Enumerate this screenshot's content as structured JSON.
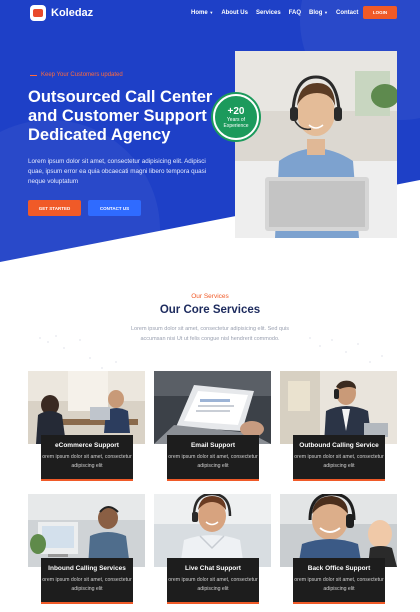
{
  "brand": {
    "name": "Koledaz"
  },
  "nav": {
    "items": [
      {
        "label": "Home",
        "dropdown": true
      },
      {
        "label": "About Us",
        "dropdown": false
      },
      {
        "label": "Services",
        "dropdown": false
      },
      {
        "label": "FAQ",
        "dropdown": false
      },
      {
        "label": "Blog",
        "dropdown": true
      },
      {
        "label": "Contact",
        "dropdown": false
      }
    ],
    "login_label": "LOGIN"
  },
  "hero": {
    "kicker": "Keep Your Customers updated",
    "title": "Outsourced Call Center and Customer Support Dedicated Agency",
    "description": "Lorem ipsum dolor sit amet, consectetur adipisicing elit. Adipisci quae, ipsum error ea quia obcaecati magni libero tempora quasi neque voluptatum",
    "primary_button": "GET STARTED",
    "secondary_button": "CONTACT US",
    "badge_number": "+20",
    "badge_label": "Years of Experience"
  },
  "services": {
    "kicker": "Our Services",
    "title": "Our Core Services",
    "description": "Lorem ipsum dolor sit amet, consectetur adipisicing elit. Sed quis accumsan nisi Ut ut felis congue nisl hendrerit commodo.",
    "cards": [
      {
        "title": "eCommerce Support",
        "text": "orem ipsum dolor sit amet, consectetur adipiscing elit"
      },
      {
        "title": "Email Support",
        "text": "orem ipsum dolor sit amet, consectetur adipiscing elit"
      },
      {
        "title": "Outbound Calling Service",
        "text": "orem ipsum dolor sit amet, consectetur adipiscing elit"
      },
      {
        "title": "Inbound Calling Services",
        "text": "orem ipsum dolor sit amet, consectetur adipiscing elit"
      },
      {
        "title": "Live Chat Support",
        "text": "orem ipsum dolor sit amet, consectetur adipiscing elit"
      },
      {
        "title": "Back Office Support",
        "text": "orem ipsum dolor sit amet, consectetur adipiscing elit"
      }
    ]
  },
  "colors": {
    "hero_blue": "#1e40c7",
    "accent_orange": "#f05a28",
    "button_blue": "#2f6bff",
    "badge_green": "#1c9a5c",
    "card_dark": "#1d1d1d"
  }
}
